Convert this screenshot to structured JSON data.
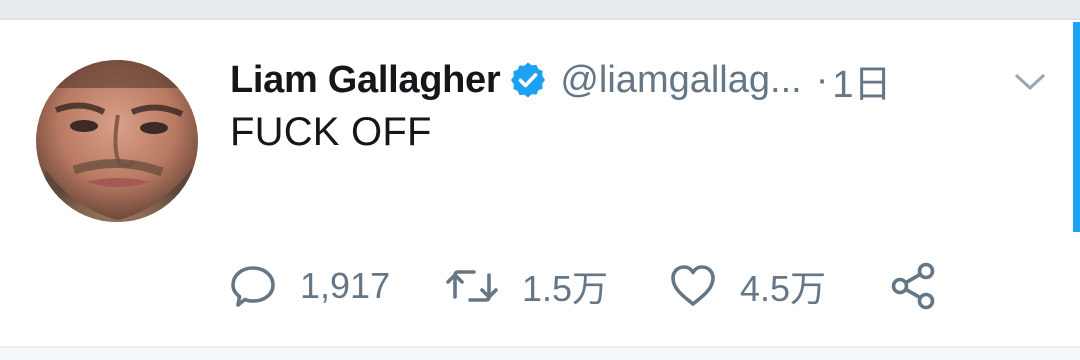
{
  "tweet": {
    "author_name": "Liam Gallagher",
    "handle": "@liamgallag...",
    "separator": "·",
    "timestamp": "1日",
    "text": "FUCK OFF",
    "verified_icon": "verified-badge-icon",
    "menu_icon": "chevron-down-icon"
  },
  "actions": {
    "reply_count": "1,917",
    "retweet_count": "1.5万",
    "like_count": "4.5万",
    "reply_icon": "reply-icon",
    "retweet_icon": "retweet-icon",
    "like_icon": "heart-icon",
    "share_icon": "share-icon"
  },
  "colors": {
    "verified_blue": "#1da1f2",
    "secondary_text": "#657786",
    "primary_text": "#14171a"
  }
}
